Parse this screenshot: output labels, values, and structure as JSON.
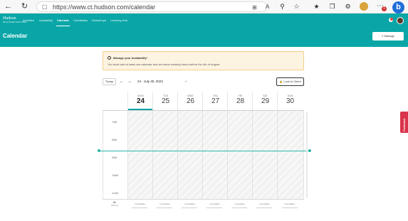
{
  "browser": {
    "url": "https://www.ct.hudson.com/calendar",
    "badge_count": "1",
    "bing_label": "b"
  },
  "app": {
    "logo": "Hudson",
    "logo_sub": "RPO & TALENT SOLUTIONS",
    "nav": [
      "Activities",
      "Availability",
      "Calendar",
      "Candidates",
      "Workshops",
      "Learning Hub"
    ],
    "active_nav": "Calendar"
  },
  "header": {
    "title": "Calendar",
    "manage_label": "Manage"
  },
  "alert": {
    "title": "Manage your Availability*",
    "message": "You must add at least one calendar and set some working hours before the 4th of August."
  },
  "toolbar": {
    "today_label": "Today",
    "prev_label": "←",
    "next_label": "→",
    "range_label": "24 - July 30, 2023",
    "lock_label": "Lock to Client"
  },
  "days": [
    {
      "name": "MON",
      "num": "24"
    },
    {
      "name": "TUE",
      "num": "25"
    },
    {
      "name": "WED",
      "num": "26"
    },
    {
      "name": "THU",
      "num": "27"
    },
    {
      "name": "FRI",
      "num": "28"
    },
    {
      "name": "SAT",
      "num": "29"
    },
    {
      "name": "SUN",
      "num": "30"
    }
  ],
  "time_labels": [
    "7AM",
    "8AM",
    "9AM",
    "10AM",
    "11AM"
  ],
  "footer": {
    "tz": "8h",
    "tz_sub": "(GMT+1)",
    "cell_label": "Unavailable"
  },
  "feedback": "Feedback",
  "colors": {
    "brand": "#0aa6a7",
    "now_line": "#2cb6a8",
    "alert_bg": "#fdf3e1",
    "feedback": "#d9344a"
  }
}
